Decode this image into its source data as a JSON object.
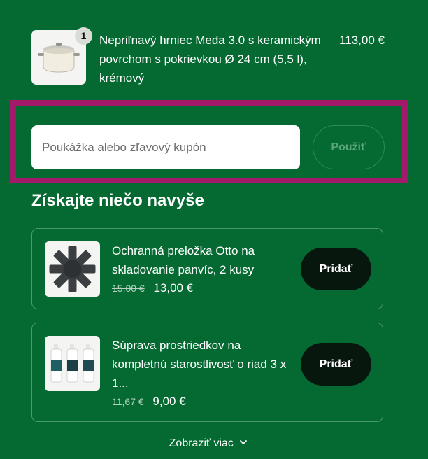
{
  "cart": {
    "item": {
      "quantity": "1",
      "title": "Nepriľnavý hrniec Meda 3.0 s keramickým povrchom s pokrievkou Ø 24 cm (5,5 l), krémový",
      "price": "113,00 €",
      "image_icon": "pot-image"
    }
  },
  "coupon": {
    "placeholder": "Poukážka alebo zľavový kupón",
    "value": "",
    "apply_label": "Použiť",
    "highlight_color": "#a31a6b"
  },
  "upsell": {
    "heading": "Získajte niečo navyše",
    "items": [
      {
        "title": "Ochranná preložka Otto na skladovanie panvíc, 2 kusy",
        "old_price": "15,00 €",
        "new_price": "13,00 €",
        "add_label": "Pridať",
        "image_icon": "pan-protector-image"
      },
      {
        "title": "Súprava prostriedkov na kompletnú starostlivosť o riad 3 x 1...",
        "old_price": "11,67 €",
        "new_price": "9,00 €",
        "add_label": "Pridať",
        "image_icon": "cleaning-bottles-image"
      }
    ],
    "show_more_label": "Zobraziť viac",
    "show_more_icon": "chevron-down-icon"
  },
  "colors": {
    "background": "#056a32",
    "button_dark": "#07170e",
    "accent_highlight": "#a31a6b"
  }
}
